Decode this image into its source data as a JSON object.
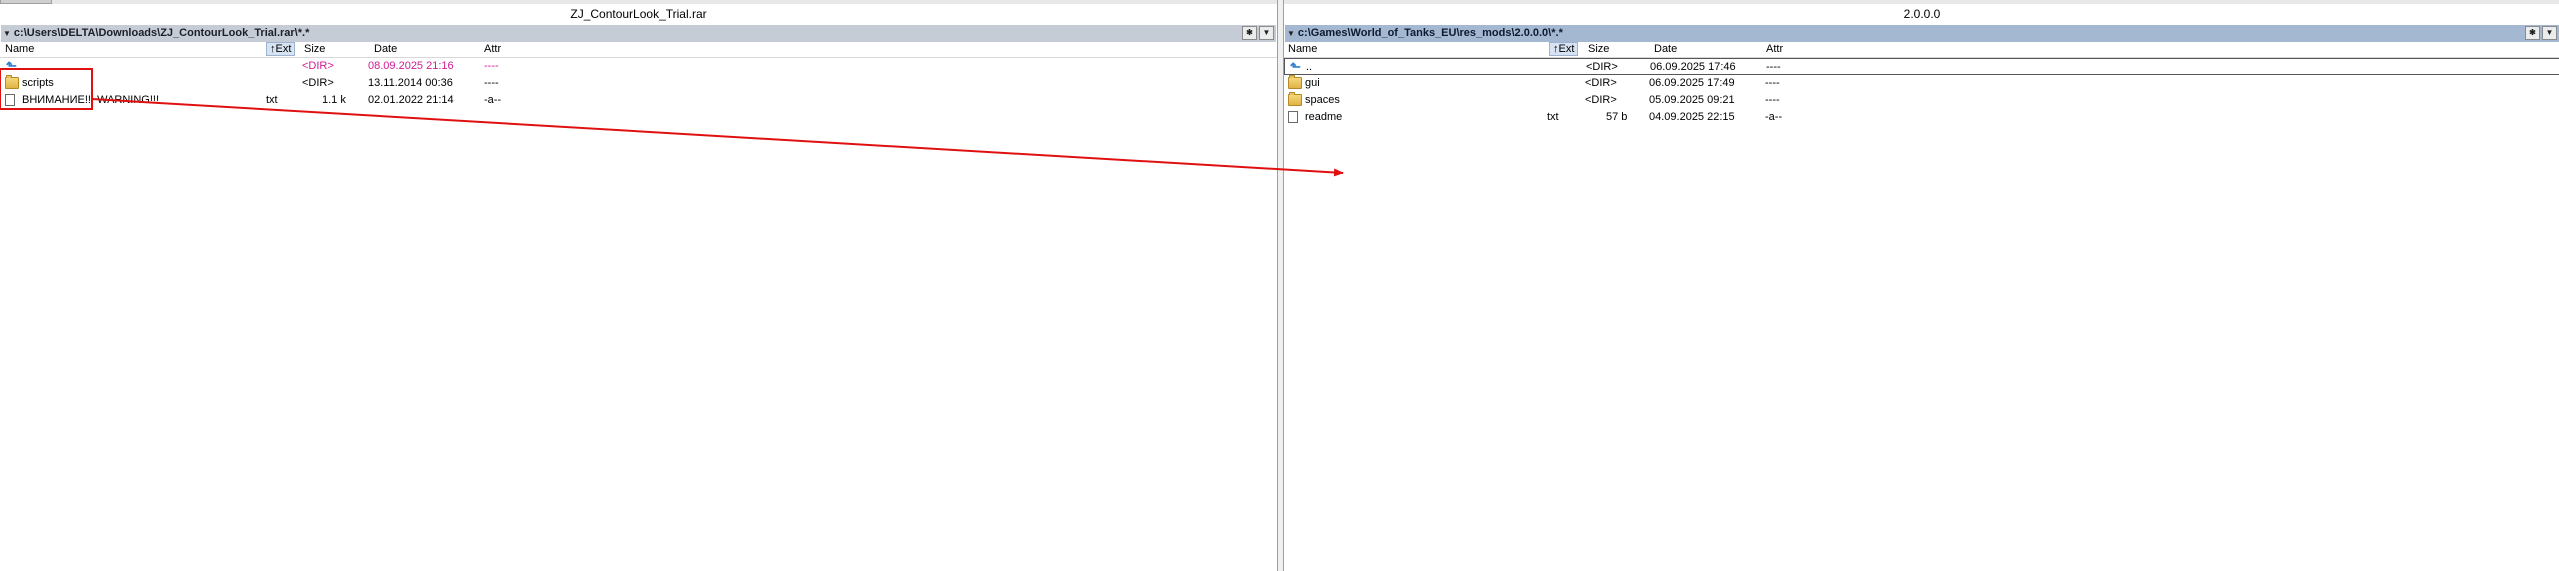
{
  "left_panel": {
    "title": "ZJ_ContourLook_Trial.rar",
    "path": "c:\\Users\\DELTA\\Downloads\\ZJ_ContourLook_Trial.rar\\*.*",
    "columns": {
      "name": "Name",
      "ext": "Ext",
      "size": "Size",
      "date": "Date",
      "attr": "Attr",
      "sort_arrow": "↑"
    },
    "rows": [
      {
        "name": "",
        "ext": "",
        "size": "<DIR>",
        "date": "08.09.2025 21:16",
        "attr": "----",
        "icon": "up-dir-icon"
      },
      {
        "name": "scripts",
        "ext": "",
        "size": "<DIR>",
        "date": "13.11.2014 00:36",
        "attr": "----",
        "icon": "folder-icon"
      },
      {
        "name": "ВНИМАНИЕ!!! WARNING!!!",
        "ext": "txt",
        "size": "1.1 k",
        "date": "02.01.2022 21:14",
        "attr": "-a--",
        "icon": "file-icon"
      }
    ]
  },
  "right_panel": {
    "title": "2.0.0.0",
    "path": "c:\\Games\\World_of_Tanks_EU\\res_mods\\2.0.0.0\\*.*",
    "columns": {
      "name": "Name",
      "ext": "Ext",
      "size": "Size",
      "date": "Date",
      "attr": "Attr",
      "sort_arrow": "↑"
    },
    "rows": [
      {
        "name": "..",
        "ext": "",
        "size": "<DIR>",
        "date": "06.09.2025 17:46",
        "attr": "----",
        "icon": "up-dir-icon"
      },
      {
        "name": "gui",
        "ext": "",
        "size": "<DIR>",
        "date": "06.09.2025 17:49",
        "attr": "----",
        "icon": "folder-icon"
      },
      {
        "name": "spaces",
        "ext": "",
        "size": "<DIR>",
        "date": "05.09.2025 09:21",
        "attr": "----",
        "icon": "folder-icon"
      },
      {
        "name": "readme",
        "ext": "txt",
        "size": "57 b",
        "date": "04.09.2025 22:15",
        "attr": "-a--",
        "icon": "file-icon"
      }
    ]
  },
  "path_buttons": {
    "star": "✱",
    "dropdown": "▼"
  },
  "caret": "▼",
  "colors": {
    "annotation": "#e01010",
    "highlight_text": "#d01b92"
  }
}
